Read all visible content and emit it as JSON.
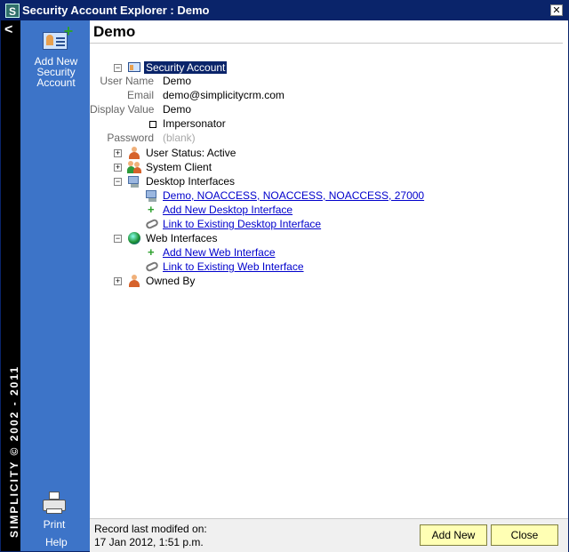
{
  "window": {
    "title": "Security Account Explorer : Demo",
    "app_icon_letter": "S",
    "close_glyph": "✕"
  },
  "sidebar": {
    "collapse_glyph": "<",
    "copyright": "SIMPLICITY © 2002 - 2011",
    "add_new_label": "Add New Security Account",
    "print_label": "Print",
    "help_label": "Help"
  },
  "main": {
    "title": "Demo",
    "tree": {
      "root_label": "Security Account",
      "fields": [
        {
          "label": "User Name",
          "value": "Demo"
        },
        {
          "label": "Email",
          "value": "demo@simplicitycrm.com"
        },
        {
          "label": "Display Value",
          "value": "Demo"
        }
      ],
      "impersonator_label": "Impersonator",
      "password_label": "Password",
      "password_value": "(blank)",
      "user_status": "User Status:  Active",
      "system_client": "System Client",
      "desktop_interfaces": "Desktop Interfaces",
      "desktop_interface_item": "Demo, NOACCESS, NOACCESS, NOACCESS, 27000",
      "add_desktop_interface": "Add New Desktop Interface",
      "link_desktop_interface": "Link to Existing Desktop Interface",
      "web_interfaces": "Web Interfaces",
      "add_web_interface": "Add New Web Interface",
      "link_web_interface": "Link to Existing Web Interface",
      "owned_by": "Owned By"
    }
  },
  "footer": {
    "record_label": "Record last modifed on:",
    "record_date": "17 Jan 2012, 1:51 p.m.",
    "add_new_button": "Add New",
    "close_button": "Close"
  },
  "colors": {
    "titlebar": "#0a246a",
    "sidebar": "#3d74c8",
    "button_bg": "#ffffb4",
    "link": "#0000cc"
  }
}
